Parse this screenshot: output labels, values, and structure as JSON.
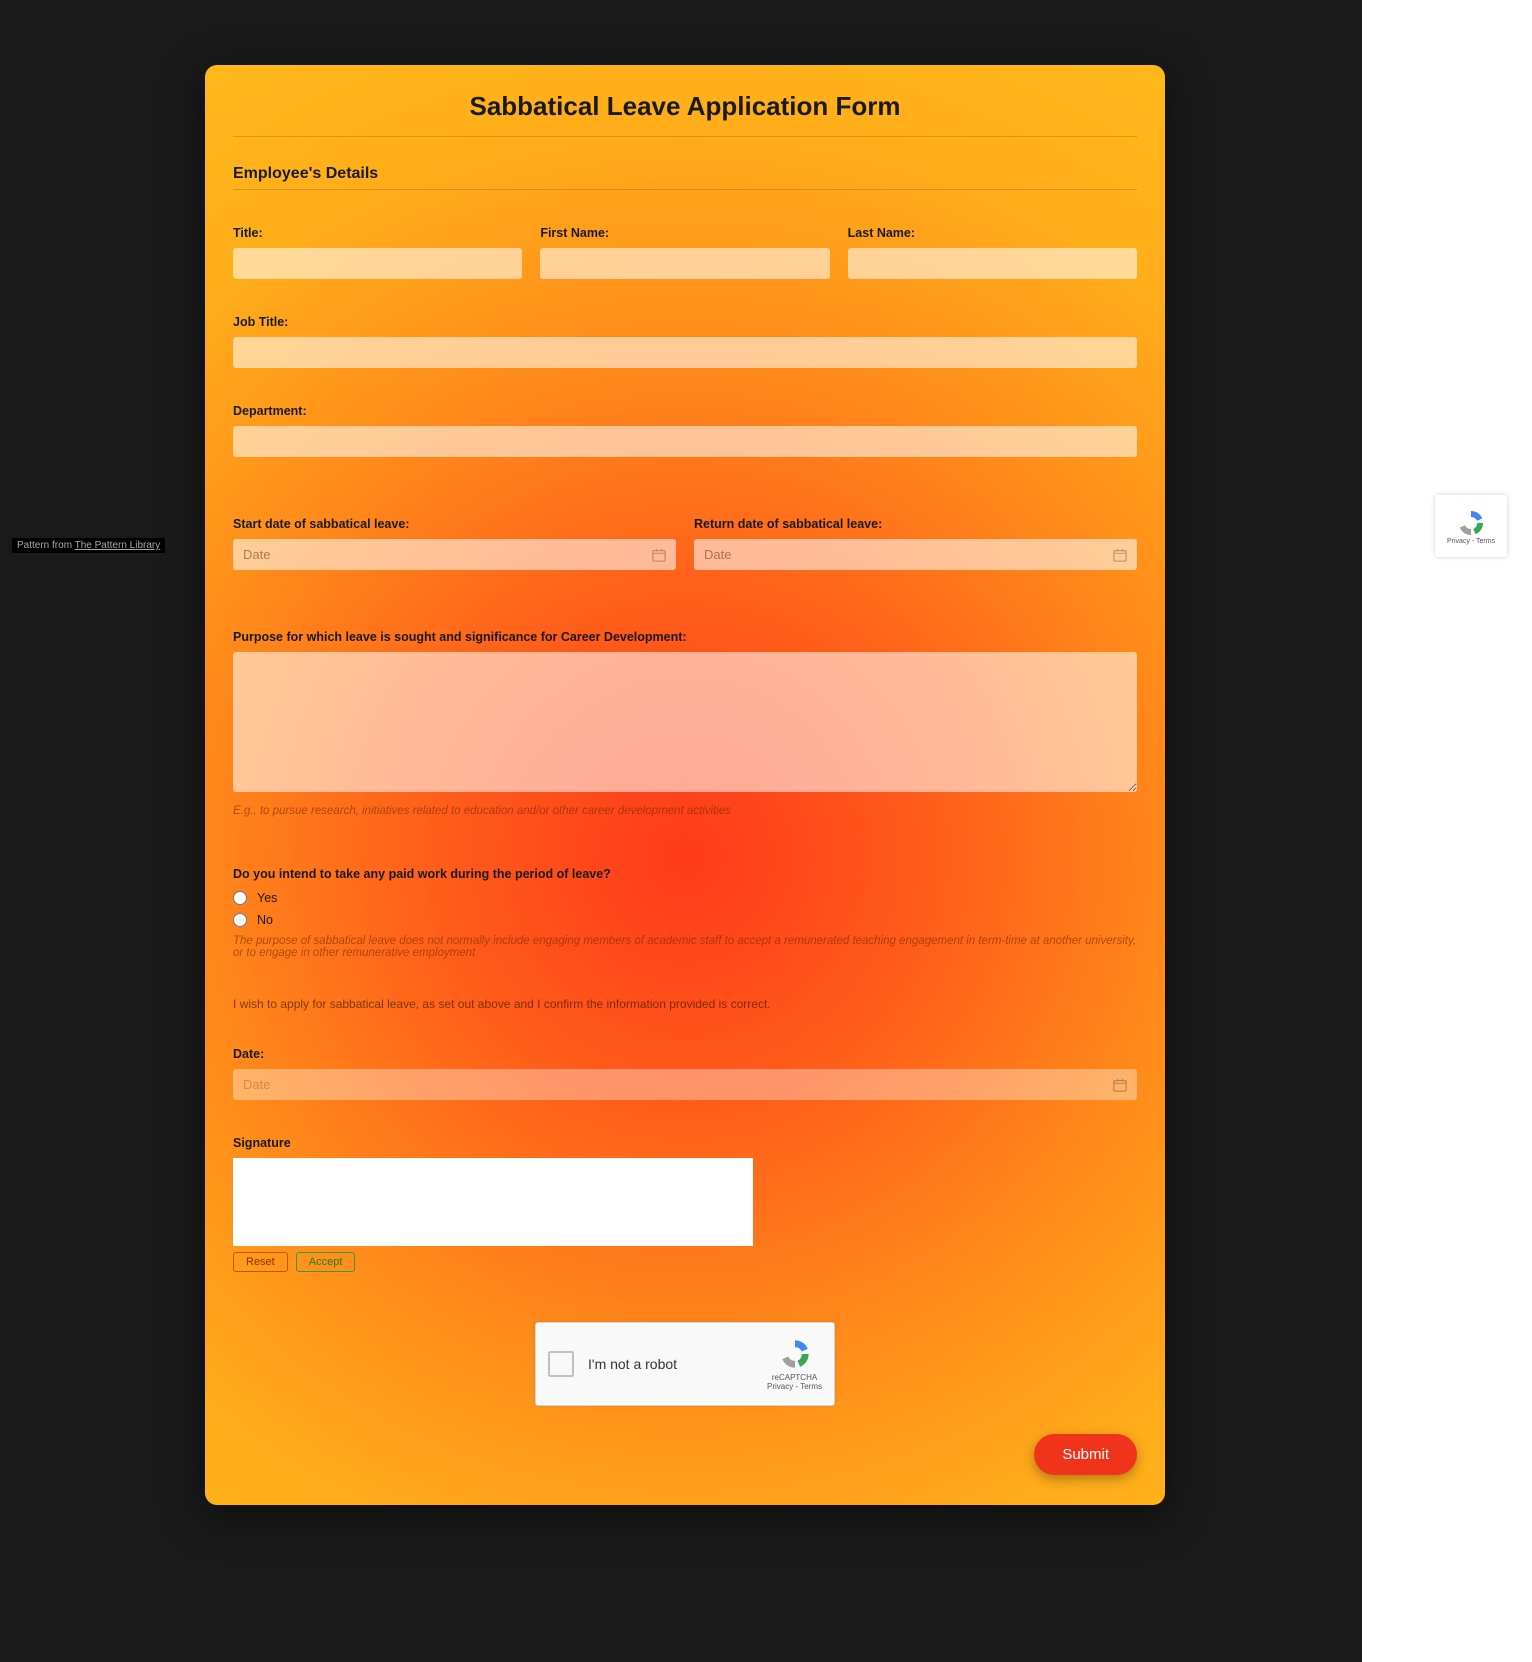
{
  "credit": {
    "prefix": "Pattern from ",
    "link": "The Pattern Library"
  },
  "form": {
    "title": "Sabbatical Leave Application Form",
    "section_header": "Employee's Details",
    "fields": {
      "title_label": "Title:",
      "first_name_label": "First Name:",
      "last_name_label": "Last Name:",
      "job_title_label": "Job Title:",
      "department_label": "Department:",
      "start_date_label": "Start date of sabbatical leave:",
      "return_date_label": "Return date of sabbatical leave:",
      "date_placeholder": "Date",
      "purpose_label": "Purpose for which leave is sought and significance for Career Development:",
      "purpose_hint": "E.g., to pursue research, initiatives related to education and/or other career development activities",
      "paid_work_label": "Do you intend to take any paid work during the period of leave?",
      "option_yes": "Yes",
      "option_no": "No",
      "paid_work_hint": "The purpose of sabbatical leave does not normally include engaging members of academic staff to accept a remunerated teaching engagement in term-time at another university, or to engage in other remunerative employment",
      "declaration": "I wish to apply for sabbatical leave, as set out above and I confirm the information provided is correct.",
      "date_label": "Date:",
      "date_disabled_placeholder": "Date",
      "signature_label": "Signature",
      "reset_btn": "Reset",
      "accept_btn": "Accept"
    },
    "captcha": {
      "label": "I'm not a robot",
      "brand": "reCAPTCHA",
      "legal": "Privacy - Terms"
    },
    "submit": "Submit"
  },
  "float_badge": {
    "brand": "reCAPTCHA",
    "legal": "Privacy - Terms"
  }
}
